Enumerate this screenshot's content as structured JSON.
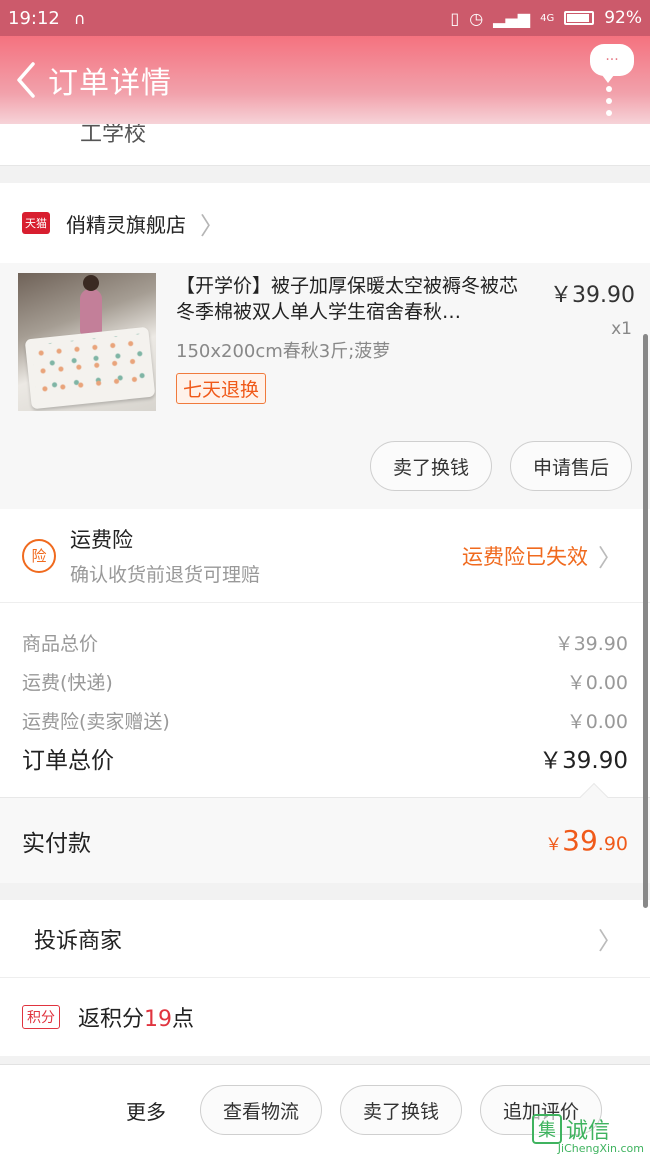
{
  "status_bar": {
    "time": "19:12",
    "network": "4G",
    "battery": "92%"
  },
  "nav": {
    "title": "订单详情",
    "more": "···"
  },
  "address": {
    "tail": "工学校"
  },
  "shop": {
    "badge": "天猫",
    "name": "俏精灵旗舰店"
  },
  "item": {
    "title": "【开学价】被子加厚保暖太空被褥冬被芯冬季棉被双人单人学生宿舍春秋…",
    "sku": "150x200cm春秋3斤;菠萝",
    "tag": "七天退换",
    "price": "￥39.90",
    "qty": "x1",
    "buttons": [
      "卖了换钱",
      "申请售后"
    ]
  },
  "insurance": {
    "icon": "险",
    "title": "运费险",
    "subtitle": "确认收货前退货可理赔",
    "status": "运费险已失效"
  },
  "prices": {
    "lines": [
      {
        "label": "商品总价",
        "value": "￥39.90"
      },
      {
        "label": "运费(快递)",
        "value": "￥0.00"
      },
      {
        "label": "运费险(卖家赠送)",
        "value": "￥0.00"
      }
    ],
    "total_label": "订单总价",
    "total_value": "￥39.90"
  },
  "paid": {
    "label": "实付款",
    "currency": "￥",
    "int": "39",
    "dec": ".90"
  },
  "complain": {
    "label": "投诉商家"
  },
  "points": {
    "badge": "积分",
    "prefix": "返积分",
    "num": "19",
    "suffix": "点"
  },
  "bottom": {
    "more": "更多",
    "buttons": [
      "查看物流",
      "卖了换钱",
      "追加评价"
    ]
  },
  "watermark": {
    "logo": "集",
    "text": "诚信",
    "url": "JiChengXin.com"
  },
  "colors": {
    "accent": "#f06a1e",
    "nav": "#f4727f",
    "red": "#e0343f"
  }
}
